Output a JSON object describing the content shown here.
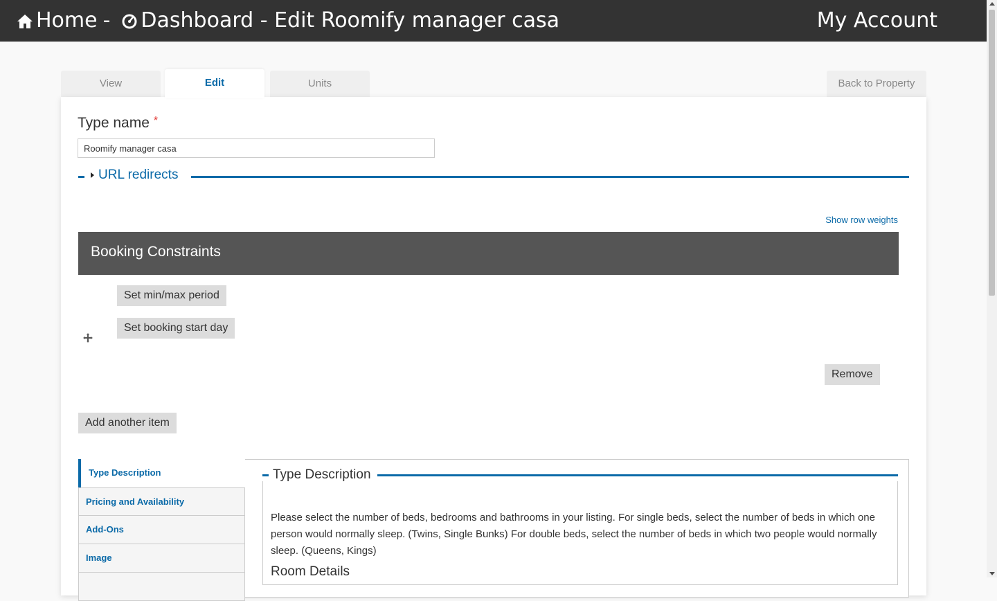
{
  "header": {
    "home_label": "Home",
    "separator": "-",
    "title": "Dashboard - Edit Roomify manager casa",
    "account_label": "My Account",
    "home_icon": "home-icon",
    "dashboard_icon": "dashboard-gauge-icon"
  },
  "tabs": {
    "view": "View",
    "edit": "Edit",
    "units": "Units",
    "back": "Back to Property"
  },
  "form": {
    "type_name_label": "Type name",
    "required_mark": "*",
    "type_name_value": "Roomify manager casa",
    "url_redirects": "URL redirects",
    "show_row_weights": "Show row weights",
    "booking_constraints": "Booking Constraints",
    "set_min_max": "Set min/max period",
    "set_booking_start": "Set booking start day",
    "remove": "Remove",
    "add_another": "Add another item"
  },
  "vertical_tabs": {
    "items": [
      "Type Description",
      "Pricing and Availability",
      "Add-Ons",
      "Image"
    ],
    "active": "Type Description"
  },
  "type_description": {
    "legend": "Type Description",
    "text": "Please select the number of beds, bedrooms and bathrooms in your listing. For single beds, select the number of beds in which one person would normally sleep. (Twins, Single Bunks) For double beds, select the number of beds in which two people would normally sleep. (Queens, Kings)",
    "room_details": "Room Details"
  },
  "colors": {
    "header_bg": "#333333",
    "accent": "#0b6aa8",
    "section_header_bg": "#555555",
    "required": "#e0302c"
  }
}
